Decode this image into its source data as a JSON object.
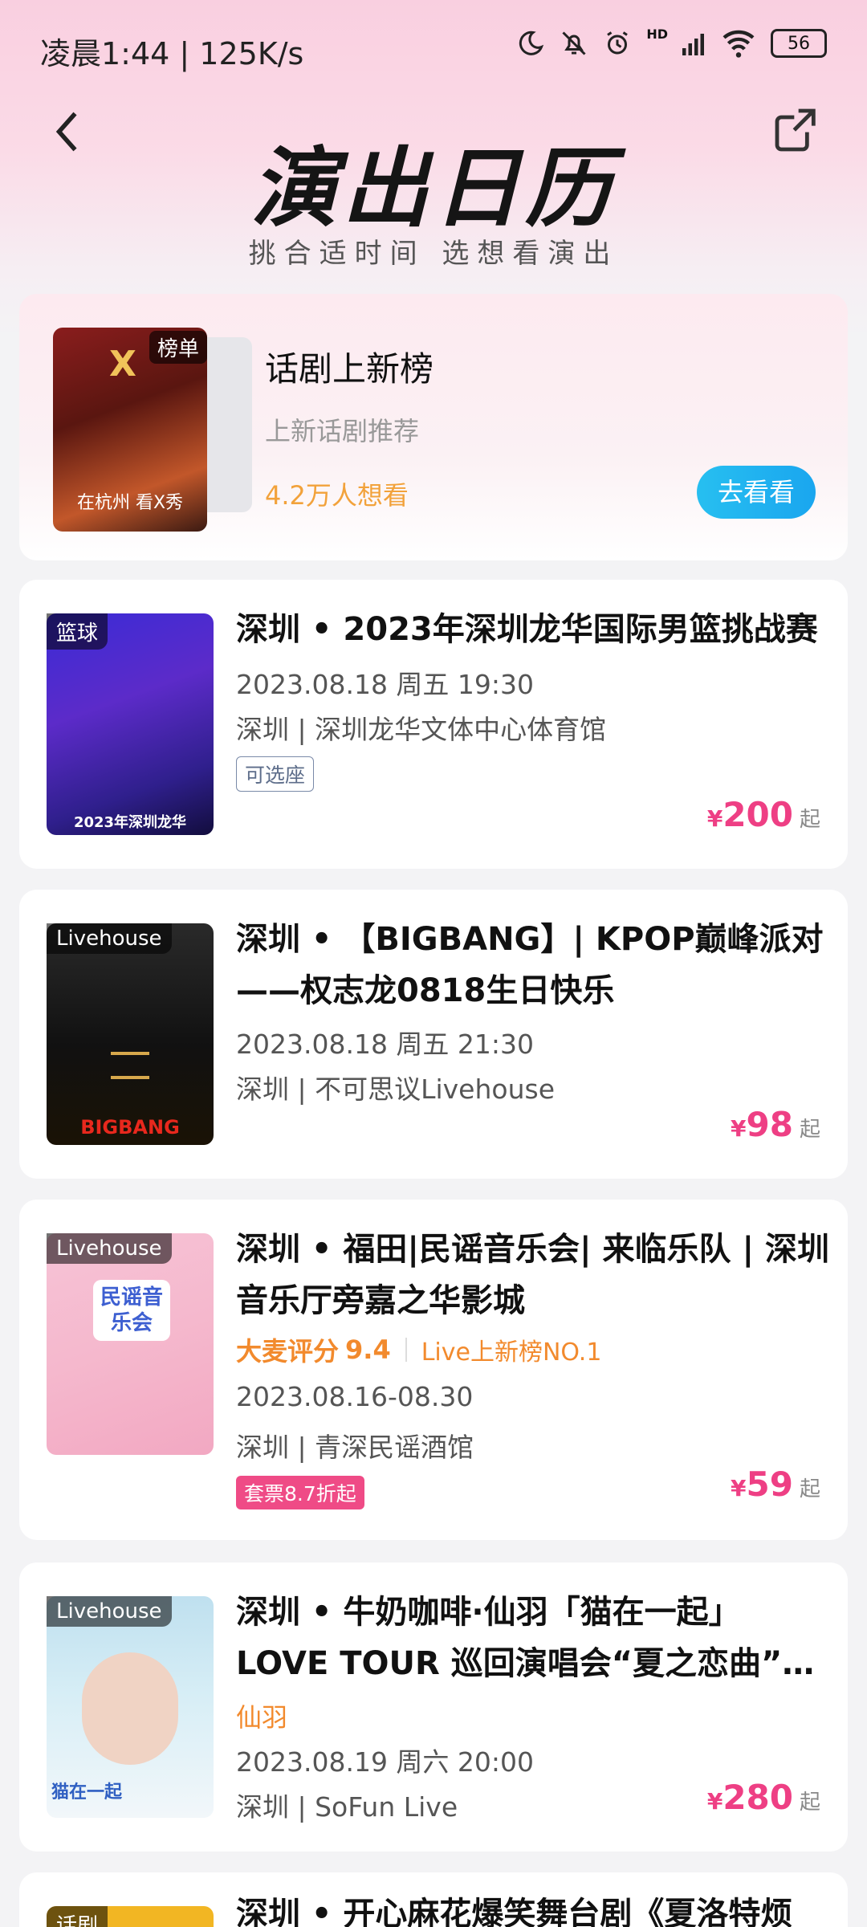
{
  "status": {
    "time": "凌晨1:44 | 125K/s",
    "battery": "56",
    "network": "HD"
  },
  "header": {
    "title": "演出日历",
    "subtitle": "挑合适时间  选想看演出"
  },
  "top_card": {
    "tag": "榜单",
    "title": "话剧上新榜",
    "subtitle": "上新话剧推荐",
    "want": "4.2万人想看",
    "button": "去看看",
    "poster_text": "在杭州 看X秀"
  },
  "items": [
    {
      "tag": "篮球",
      "title": "深圳 • 2023年深圳龙华国际男篮挑战赛",
      "date": "2023.08.18 周五 19:30",
      "venue": "深圳 | 深圳龙华文体中心体育馆",
      "chip": "可选座",
      "price": "200",
      "currency": "¥",
      "suffix": "起",
      "poster_text": "2023年深圳龙华"
    },
    {
      "tag": "Livehouse",
      "title1": "深圳 • 【BIGBANG】| KPOP巅峰派对",
      "title2": "——权志龙0818生日快乐",
      "date": "2023.08.18 周五 21:30",
      "venue": "深圳 | 不可思议Livehouse",
      "price": "98",
      "currency": "¥",
      "suffix": "起",
      "poster_text": "BIGBANG"
    },
    {
      "tag": "Livehouse",
      "title1": "深圳 • 福田|民谣音乐会| 来临乐队 | 深圳",
      "title2": "音乐厅旁嘉之华影城",
      "rating_label": "大麦评分",
      "rating": "9.4",
      "rank": "Live上新榜NO.1",
      "date": "2023.08.16-08.30",
      "venue": "深圳 | 青深民谣酒馆",
      "chip": "套票8.7折起",
      "price": "59",
      "currency": "¥",
      "suffix": "起",
      "poster_text": "民谣音乐会"
    },
    {
      "tag": "Livehouse",
      "title1": "深圳 • 牛奶咖啡·仙羽「猫在一起」",
      "title2": "LOVE TOUR 巡回演唱会“夏之恋曲”…",
      "artist": "仙羽",
      "date": "2023.08.19 周六 20:00",
      "venue": "深圳 | SoFun Live",
      "price": "280",
      "currency": "¥",
      "suffix": "起",
      "poster_text": "猫在一起"
    },
    {
      "tag": "话剧",
      "title1": "深圳 • 开心麻花爆笑舞台剧《夏洛特烦"
    }
  ]
}
